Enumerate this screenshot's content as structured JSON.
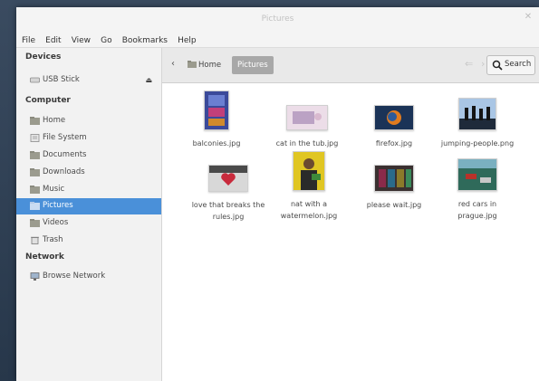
{
  "window": {
    "title": "Pictures"
  },
  "menubar": [
    "File",
    "Edit",
    "View",
    "Go",
    "Bookmarks",
    "Help"
  ],
  "sidebar": {
    "devices_heading": "Devices",
    "usb_label": "USB Stick",
    "computer_heading": "Computer",
    "computer_items": [
      "Home",
      "File System",
      "Documents",
      "Downloads",
      "Music",
      "Pictures",
      "Videos",
      "Trash"
    ],
    "active_item": "Pictures",
    "network_heading": "Network",
    "network_items": [
      "Browse Network"
    ]
  },
  "toolbar": {
    "crumb_home": "Home",
    "crumb_current": "Pictures",
    "search_label": "Search"
  },
  "files": [
    {
      "name": "balconies.jpg"
    },
    {
      "name": "cat in the tub.jpg"
    },
    {
      "name": "firefox.jpg"
    },
    {
      "name": "jumping-people.png"
    },
    {
      "name": "love that breaks the rules.jpg"
    },
    {
      "name": "nat with a watermelon.jpg"
    },
    {
      "name": "please wait.jpg"
    },
    {
      "name": "red cars in prague.jpg"
    }
  ],
  "colors": {
    "accent": "#4a90d9",
    "crumb_active": "#a8a8a8"
  }
}
